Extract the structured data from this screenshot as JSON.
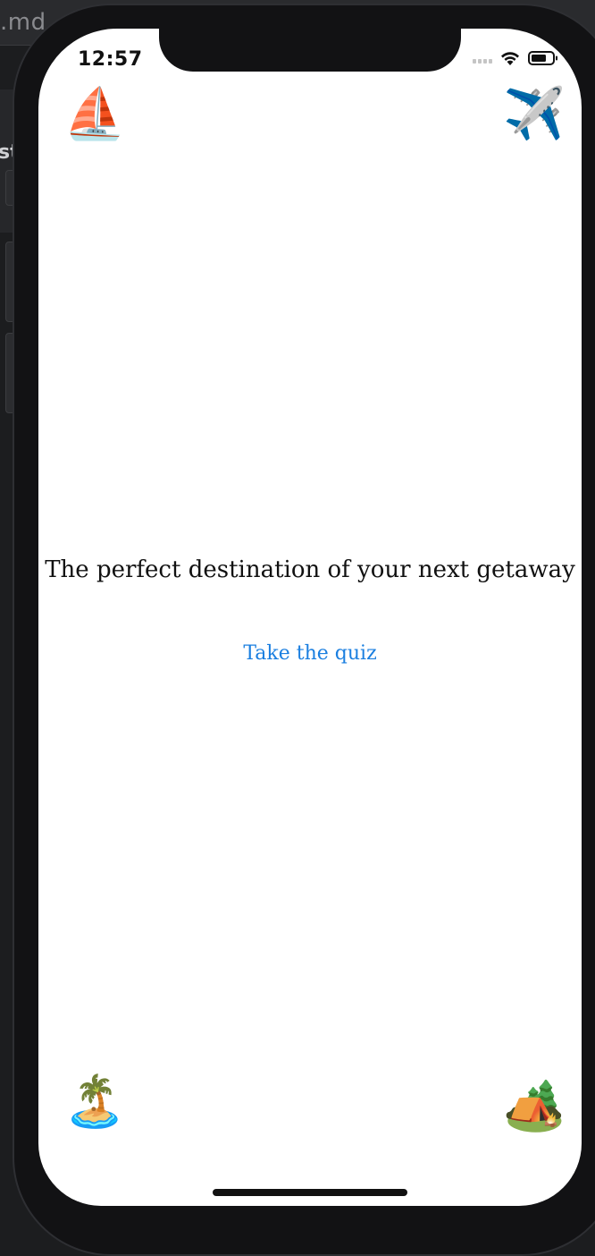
{
  "background": {
    "tab_text": ".md",
    "side_text": "st"
  },
  "status_bar": {
    "time": "12:57",
    "icons": [
      "cellular-signal-icon",
      "wifi-icon",
      "battery-icon"
    ]
  },
  "corner_emojis": {
    "top_left": {
      "icon": "sailboat-icon",
      "glyph": "⛵"
    },
    "top_right": {
      "icon": "airplane-icon",
      "glyph": "✈️"
    },
    "bottom_left": {
      "icon": "desert-island-icon",
      "glyph": "🏝️"
    },
    "bottom_right": {
      "icon": "camping-tent-icon",
      "glyph": "🏕️"
    }
  },
  "main": {
    "headline": "The perfect destination of your next getaway",
    "quiz_link": "Take the quiz"
  },
  "colors": {
    "link": "#1b7fe0",
    "text": "#111111",
    "screen_bg": "#ffffff"
  }
}
